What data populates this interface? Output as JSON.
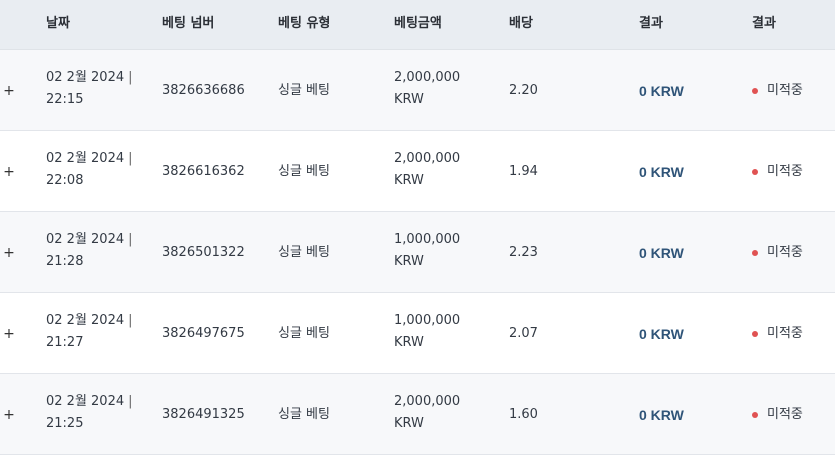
{
  "columns": [
    "날짜",
    "베팅 넘버",
    "베팅 유형",
    "베팅금액",
    "배당",
    "결과",
    "결과"
  ],
  "expand_symbol": "+",
  "date_separator": "|",
  "status_dot_color": "#e05252",
  "win_color": "#2f5478",
  "rows": [
    {
      "date": "02 2월 2024",
      "time": "22:15",
      "bet_number": "3826636686",
      "bet_type": "싱글 베팅",
      "amount": "2,000,000",
      "currency": "KRW",
      "odds": "2.20",
      "winnings": "0 KRW",
      "status": "미적중"
    },
    {
      "date": "02 2월 2024",
      "time": "22:08",
      "bet_number": "3826616362",
      "bet_type": "싱글 베팅",
      "amount": "2,000,000",
      "currency": "KRW",
      "odds": "1.94",
      "winnings": "0 KRW",
      "status": "미적중"
    },
    {
      "date": "02 2월 2024",
      "time": "21:28",
      "bet_number": "3826501322",
      "bet_type": "싱글 베팅",
      "amount": "1,000,000",
      "currency": "KRW",
      "odds": "2.23",
      "winnings": "0 KRW",
      "status": "미적중"
    },
    {
      "date": "02 2월 2024",
      "time": "21:27",
      "bet_number": "3826497675",
      "bet_type": "싱글 베팅",
      "amount": "1,000,000",
      "currency": "KRW",
      "odds": "2.07",
      "winnings": "0 KRW",
      "status": "미적중"
    },
    {
      "date": "02 2월 2024",
      "time": "21:25",
      "bet_number": "3826491325",
      "bet_type": "싱글 베팅",
      "amount": "2,000,000",
      "currency": "KRW",
      "odds": "1.60",
      "winnings": "0 KRW",
      "status": "미적중"
    }
  ]
}
